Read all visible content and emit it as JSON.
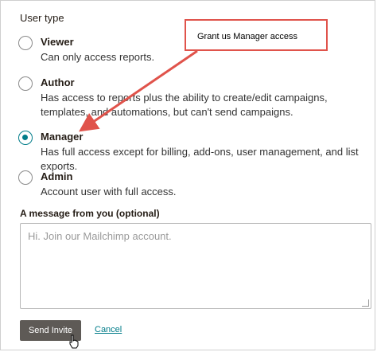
{
  "user_type": {
    "label": "User type",
    "options": [
      {
        "title": "Viewer",
        "desc": "Can only access reports.",
        "checked": false
      },
      {
        "title": "Author",
        "desc": "Has access to reports plus the ability to create/edit campaigns, templates, and automations, but can't send campaigns.",
        "checked": false
      },
      {
        "title": "Manager",
        "desc": "Has full access except for billing, add-ons, user management, and list exports.",
        "checked": true
      },
      {
        "title": "Admin",
        "desc": "Account user with full access.",
        "checked": false
      }
    ]
  },
  "message": {
    "label": "A message from you (optional)",
    "placeholder": "Hi. Join our Mailchimp account."
  },
  "actions": {
    "send_label": "Send Invite",
    "cancel_label": "Cancel"
  },
  "annotation": {
    "text": "Grant us Manager access",
    "color": "#e0534b"
  },
  "colors": {
    "accent": "#007c89",
    "button": "#5e5a56"
  }
}
